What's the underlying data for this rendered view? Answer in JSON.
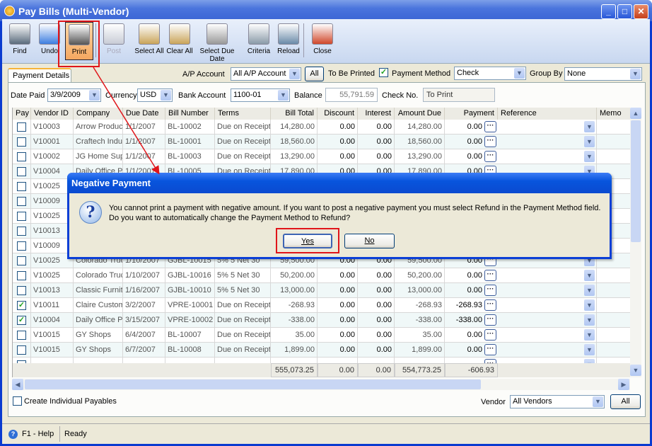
{
  "window": {
    "title": "Pay Bills (Multi-Vendor)"
  },
  "toolbar": [
    {
      "label": "Find",
      "icon": "binoculars-icon",
      "state": "normal"
    },
    {
      "label": "Undo",
      "icon": "undo-icon",
      "state": "normal"
    },
    {
      "label": "Print",
      "icon": "printer-icon",
      "state": "highlighted"
    },
    {
      "label": "Post",
      "icon": "post-icon",
      "state": "disabled"
    },
    {
      "label": "Select All",
      "icon": "clipboard-check-icon",
      "state": "normal"
    },
    {
      "label": "Clear All",
      "icon": "clipboard-eraser-icon",
      "state": "normal"
    },
    {
      "label": "Select Due Date",
      "icon": "calendar-icon",
      "state": "normal"
    },
    {
      "label": "Criteria",
      "icon": "criteria-icon",
      "state": "normal"
    },
    {
      "label": "Reload",
      "icon": "reload-icon",
      "state": "normal"
    },
    {
      "label": "Close",
      "icon": "close-window-icon",
      "state": "normal"
    }
  ],
  "tab": "Payment Details",
  "filters": {
    "ap_account_label": "A/P Account",
    "ap_account": "All A/P Account",
    "all_label": "All",
    "to_be_printed_label": "To Be Printed",
    "to_be_printed": true,
    "payment_method_label": "Payment Method",
    "payment_method": "Check",
    "group_by_label": "Group By",
    "group_by": "None",
    "date_paid_label": "Date Paid",
    "date_paid": "3/9/2009",
    "currency_label": "Currency",
    "currency": "USD",
    "bank_account_label": "Bank Account",
    "bank_account": "1100-01",
    "balance_label": "Balance",
    "balance": "55,791.59",
    "check_no_label": "Check No.",
    "check_no": "To Print"
  },
  "grid": {
    "columns": [
      "Pay",
      "Vendor ID",
      "Company",
      "Due Date",
      "Bill Number",
      "Terms",
      "Bill Total",
      "Discount",
      "Interest",
      "Amount Due",
      "Payment",
      "Reference",
      "Memo"
    ],
    "rows": [
      {
        "pay": false,
        "vendor": "V10003",
        "company": "Arrow Produc",
        "due": "1/1/2007",
        "bill": "BL-10002",
        "terms": "Due on Receipt",
        "total": "14,280.00",
        "discount": "0.00",
        "interest": "0.00",
        "amount_due": "14,280.00",
        "payment": "0.00"
      },
      {
        "pay": false,
        "vendor": "V10001",
        "company": "Craftech Indu",
        "due": "1/1/2007",
        "bill": "BL-10001",
        "terms": "Due on Receipt",
        "total": "18,560.00",
        "discount": "0.00",
        "interest": "0.00",
        "amount_due": "18,560.00",
        "payment": "0.00"
      },
      {
        "pay": false,
        "vendor": "V10002",
        "company": "JG Home Supp",
        "due": "1/1/2007",
        "bill": "BL-10003",
        "terms": "Due on Receipt",
        "total": "13,290.00",
        "discount": "0.00",
        "interest": "0.00",
        "amount_due": "13,290.00",
        "payment": "0.00"
      },
      {
        "pay": false,
        "vendor": "V10004",
        "company": "Daily Office P",
        "due": "1/1/2007",
        "bill": "BL-10005",
        "terms": "Due on Receipt",
        "total": "17,890.00",
        "discount": "0.00",
        "interest": "0.00",
        "amount_due": "17,890.00",
        "payment": "0.00"
      },
      {
        "pay": false,
        "vendor": "V10025"
      },
      {
        "pay": false,
        "vendor": "V10009"
      },
      {
        "pay": false,
        "vendor": "V10025"
      },
      {
        "pay": false,
        "vendor": "V10013"
      },
      {
        "pay": false,
        "vendor": "V10009"
      },
      {
        "pay": false,
        "vendor": "V10025",
        "company": "Colorado Truc",
        "due": "1/10/2007",
        "bill": "GJBL-10015",
        "terms": "5% 5 Net 30",
        "total": "59,500.00",
        "discount": "0.00",
        "interest": "0.00",
        "amount_due": "59,500.00",
        "payment": "0.00"
      },
      {
        "pay": false,
        "vendor": "V10025",
        "company": "Colorado Truc",
        "due": "1/10/2007",
        "bill": "GJBL-10016",
        "terms": "5% 5 Net 30",
        "total": "50,200.00",
        "discount": "0.00",
        "interest": "0.00",
        "amount_due": "50,200.00",
        "payment": "0.00"
      },
      {
        "pay": false,
        "vendor": "V10013",
        "company": "Classic Furnit",
        "due": "1/16/2007",
        "bill": "GJBL-10010",
        "terms": "5% 5 Net 30",
        "total": "13,000.00",
        "discount": "0.00",
        "interest": "0.00",
        "amount_due": "13,000.00",
        "payment": "0.00"
      },
      {
        "pay": true,
        "vendor": "V10011",
        "company": "Claire Custom",
        "due": "3/2/2007",
        "bill": "VPRE-10001",
        "terms": "Due on Receipt",
        "total": "-268.93",
        "discount": "0.00",
        "interest": "0.00",
        "amount_due": "-268.93",
        "payment": "-268.93"
      },
      {
        "pay": true,
        "vendor": "V10004",
        "company": "Daily Office P",
        "due": "3/15/2007",
        "bill": "VPRE-10002",
        "terms": "Due on Receipt",
        "total": "-338.00",
        "discount": "0.00",
        "interest": "0.00",
        "amount_due": "-338.00",
        "payment": "-338.00"
      },
      {
        "pay": false,
        "vendor": "V10015",
        "company": "GY Shops",
        "due": "6/4/2007",
        "bill": "BL-10007",
        "terms": "Due on Receipt",
        "total": "35.00",
        "discount": "0.00",
        "interest": "0.00",
        "amount_due": "35.00",
        "payment": "0.00"
      },
      {
        "pay": false,
        "vendor": "V10015",
        "company": "GY Shops",
        "due": "6/7/2007",
        "bill": "BL-10008",
        "terms": "Due on Receipt",
        "total": "1,899.00",
        "discount": "0.00",
        "interest": "0.00",
        "amount_due": "1,899.00",
        "payment": "0.00"
      },
      {
        "pay": false
      }
    ],
    "totals": {
      "total": "555,073.25",
      "discount": "0.00",
      "interest": "0.00",
      "amount_due": "554,773.25",
      "payment": "-606.93"
    }
  },
  "bottom": {
    "create_individual_label": "Create Individual Payables",
    "create_individual": false,
    "vendor_label": "Vendor",
    "vendor": "All Vendors",
    "all_label": "All"
  },
  "status": {
    "help": "F1 - Help",
    "text": "Ready"
  },
  "dialog": {
    "title": "Negative Payment",
    "line1": "You cannot print a payment with negative amount. If you want to post a negative payment you must select Refund in the Payment Method field.",
    "line2": "Do you want to automatically change the Payment Method to Refund?",
    "yes": "Yes",
    "no": "No"
  },
  "colors": {
    "title_blue": "#3a64d4",
    "highlight": "#e0151a",
    "print_button": "#f4a760"
  }
}
